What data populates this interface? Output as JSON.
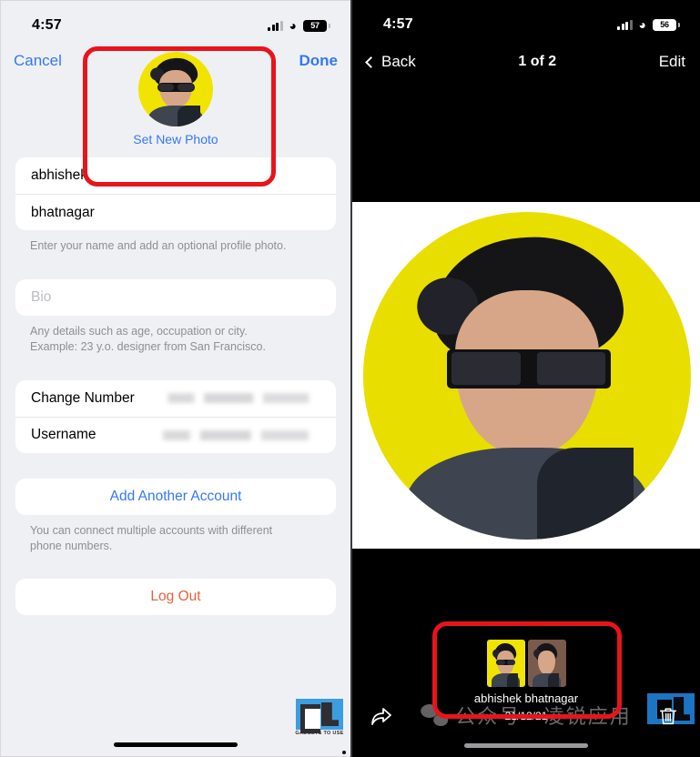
{
  "left": {
    "status": {
      "time": "4:57",
      "battery_level": "57",
      "signal_icon": "cellular-bars-icon",
      "wifi_icon": "wifi-icon",
      "battery_icon": "battery-icon"
    },
    "nav": {
      "cancel_label": "Cancel",
      "done_label": "Done"
    },
    "profile": {
      "set_photo_label": "Set New Photo",
      "avatar_bg": "#f0e400",
      "avatar_icon": "profile-avatar"
    },
    "name_fields": {
      "first_name": "abhishek",
      "last_name": "bhatnagar"
    },
    "name_hint": "Enter your name and add an optional profile photo.",
    "bio": {
      "placeholder": "Bio",
      "value": ""
    },
    "bio_hint_line1": "Any details such as age, occupation or city.",
    "bio_hint_line2": "Example: 23 y.o. designer from San Francisco.",
    "account": {
      "change_number_label": "Change Number",
      "username_label": "Username"
    },
    "add_account_label": "Add Another Account",
    "add_account_hint_line1": "You can connect multiple accounts with different",
    "add_account_hint_line2": "phone numbers.",
    "logout_label": "Log Out",
    "watermark": {
      "caption": "GADGETS TO USE"
    },
    "colors": {
      "accent_blue": "#3478f6",
      "destructive": "#e8603c",
      "highlight_red": "#e8141b",
      "background": "#eff0f4"
    }
  },
  "right": {
    "status": {
      "time": "4:57",
      "battery_level": "56",
      "signal_icon": "cellular-bars-icon",
      "wifi_icon": "wifi-icon",
      "battery_icon": "battery-icon"
    },
    "nav": {
      "back_label": "Back",
      "back_icon": "chevron-left-icon",
      "title": "1 of 2",
      "edit_label": "Edit"
    },
    "photo": {
      "avatar_bg": "#e8de00",
      "avatar_icon": "profile-photo-large"
    },
    "thumbnails": [
      {
        "name": "thumbnail-1",
        "bg": "#f0e400"
      },
      {
        "name": "thumbnail-2",
        "bg": "#7a5a4a"
      }
    ],
    "caption": {
      "name": "abhishek bhatnagar",
      "date": "21/12/21"
    },
    "toolbar": {
      "share_icon": "share-icon",
      "delete_icon": "trash-icon"
    },
    "watermark": {
      "wechat_text": "公众号 · 凌锐应用"
    },
    "colors": {
      "background": "#000000",
      "highlight_red": "#e8141b"
    }
  }
}
